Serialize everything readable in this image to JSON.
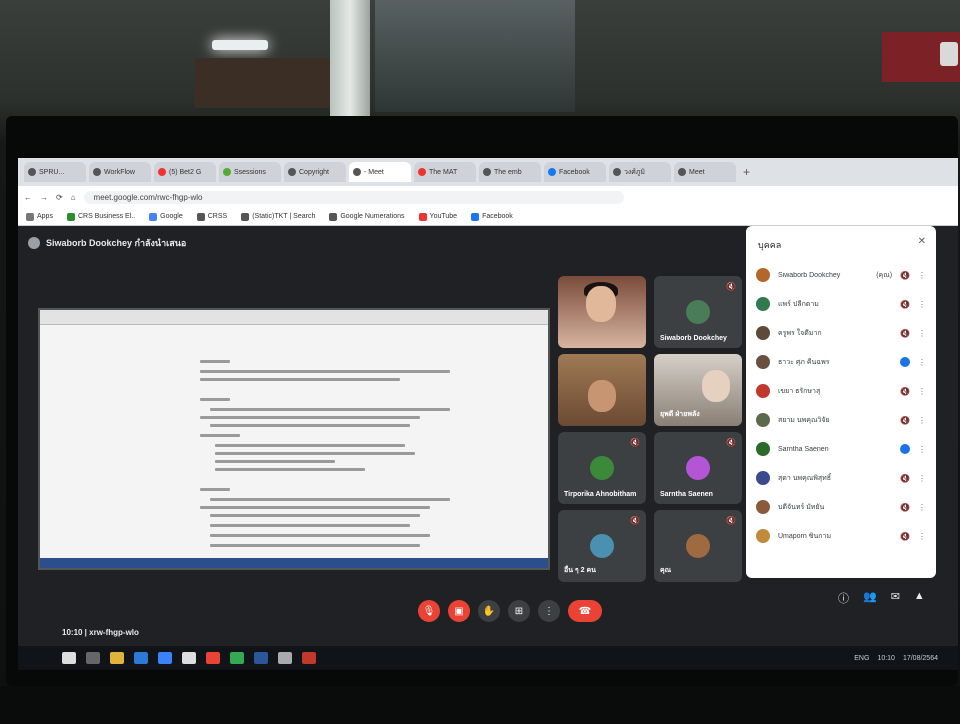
{
  "scene": {
    "colors": {
      "meet_bg": "#202124",
      "red_button": "#ea4335",
      "blue_dot": "#1a73e8"
    }
  },
  "browser": {
    "tabs": [
      {
        "label": "SPRU...",
        "favicon": "#555"
      },
      {
        "label": "WorkFlow",
        "favicon": "#555"
      },
      {
        "label": "(5) Bet2 G",
        "favicon": "#e33"
      },
      {
        "label": "Ssessions",
        "favicon": "#5a3"
      },
      {
        "label": "Copyright",
        "favicon": "#555"
      },
      {
        "label": "- Meet",
        "favicon": "#555",
        "active": true
      },
      {
        "label": "The MAT",
        "favicon": "#e33"
      },
      {
        "label": "The emb",
        "favicon": "#555"
      },
      {
        "label": "Facebook",
        "favicon": "#1877f2"
      },
      {
        "label": "วงศ์ภูมิ",
        "favicon": "#555"
      },
      {
        "label": "Meet",
        "favicon": "#555"
      }
    ],
    "url": "meet.google.com/rwc-fhgp-wlo",
    "bookmarks": [
      {
        "label": "Apps",
        "color": "#777"
      },
      {
        "label": "CRS Business El..",
        "color": "#2a8f2a"
      },
      {
        "label": "Google",
        "color": "#4285f4"
      },
      {
        "label": "CRSS",
        "color": "#555"
      },
      {
        "label": "(Static)TKT | Search",
        "color": "#555"
      },
      {
        "label": "Google Numerations",
        "color": "#555"
      },
      {
        "label": "YouTube",
        "color": "#e33"
      },
      {
        "label": "Facebook",
        "color": "#1877f2"
      }
    ]
  },
  "meet": {
    "presenter": "Siwaborb Dookchey กำลังนำเสนอ",
    "tiles": [
      {
        "name": "",
        "type": "video-1"
      },
      {
        "name": "Siwaborb Dookchey",
        "type": "avatar",
        "color": "#4a7c59"
      },
      {
        "name": "",
        "type": "video-3"
      },
      {
        "name": "ยุพดี ฝ่ายพลัง",
        "type": "video-4"
      },
      {
        "name": "Tirporika Ahnobitham",
        "type": "avatar",
        "color": "#3a8a3a"
      },
      {
        "name": "Sarntha Saenen",
        "type": "avatar",
        "color": "#b455d6"
      },
      {
        "name": "อื่น ๆ 2 คน",
        "type": "avatar",
        "color": "#4a90b0"
      },
      {
        "name": "คุณ",
        "type": "avatar",
        "color": "#a06a40"
      }
    ],
    "meeting_info": "10:10 | xrw-fhgp-wlo",
    "controls": [
      "mic-off",
      "cam-off",
      "hand",
      "present",
      "more",
      "hangup"
    ],
    "panel": {
      "title": "บุคคล",
      "participants": [
        {
          "name": "Siwaborb Dookchey",
          "tag": "(คุณ)",
          "color": "#b3672a"
        },
        {
          "name": "แพร์ ปลีกตาม",
          "color": "#2f7a4f"
        },
        {
          "name": "ครูพร ใจดีมาก",
          "color": "#5d4a3a"
        },
        {
          "name": "ธาวะ ศุภ คืนฉพร",
          "color": "#6a5040"
        },
        {
          "name": "เขยา ธรักษาสุ",
          "color": "#c0392b"
        },
        {
          "name": "สยาม นพคุณวิจัย",
          "color": "#5a6a4a"
        },
        {
          "name": "Sarntha Saenen",
          "color": "#2a6a2a"
        },
        {
          "name": "สุดา นพคุณพิสุทธิ์",
          "color": "#3a4a8a"
        },
        {
          "name": "บดีจันทร์ มัทยัน",
          "color": "#8a5a3a"
        },
        {
          "name": "Umaporn ซินกาม",
          "color": "#c08a3a"
        }
      ]
    }
  },
  "taskbar": {
    "tray_text": "ENG",
    "time": "10:10",
    "date": "17/08/2564"
  }
}
